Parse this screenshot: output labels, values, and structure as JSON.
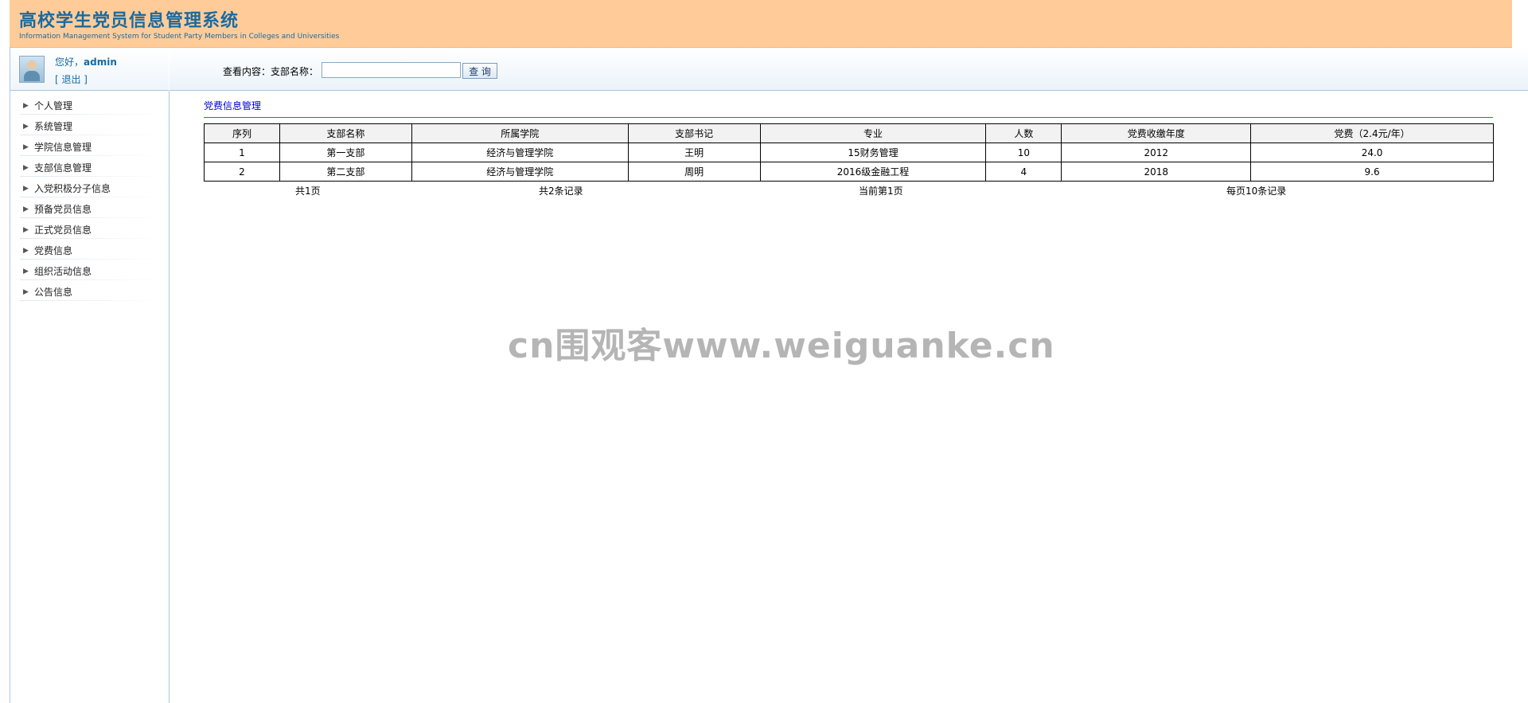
{
  "header": {
    "title": "高校学生党员信息管理系统",
    "subtitle": "Information Management System for Student Party Members in Colleges and Universities"
  },
  "user": {
    "greeting": "您好，",
    "username": "admin",
    "logout": "[ 退出 ]"
  },
  "sidebar": {
    "items": [
      {
        "label": "个人管理"
      },
      {
        "label": "系统管理"
      },
      {
        "label": "学院信息管理"
      },
      {
        "label": "支部信息管理"
      },
      {
        "label": "入党积极分子信息"
      },
      {
        "label": "预备党员信息"
      },
      {
        "label": "正式党员信息"
      },
      {
        "label": "党费信息"
      },
      {
        "label": "组织活动信息"
      },
      {
        "label": "公告信息"
      }
    ]
  },
  "search": {
    "label": "查看内容：支部名称：",
    "value": "",
    "placeholder": "",
    "button": "查 询"
  },
  "main": {
    "title": "党费信息管理",
    "columns": [
      "序列",
      "支部名称",
      "所属学院",
      "支部书记",
      "专业",
      "人数",
      "党费收缴年度",
      "党费（2.4元/年）"
    ],
    "rows": [
      [
        "1",
        "第一支部",
        "经济与管理学院",
        "王明",
        "15财务管理",
        "10",
        "2012",
        "24.0"
      ],
      [
        "2",
        "第二支部",
        "经济与管理学院",
        "周明",
        "2016级金融工程",
        "4",
        "2018",
        "9.6"
      ]
    ],
    "pager": {
      "total_pages": "共1页",
      "total_records": "共2条记录",
      "current_page": "当前第1页",
      "per_page": "每页10条记录"
    }
  },
  "watermark": "cn围观客www.weiguanke.cn"
}
